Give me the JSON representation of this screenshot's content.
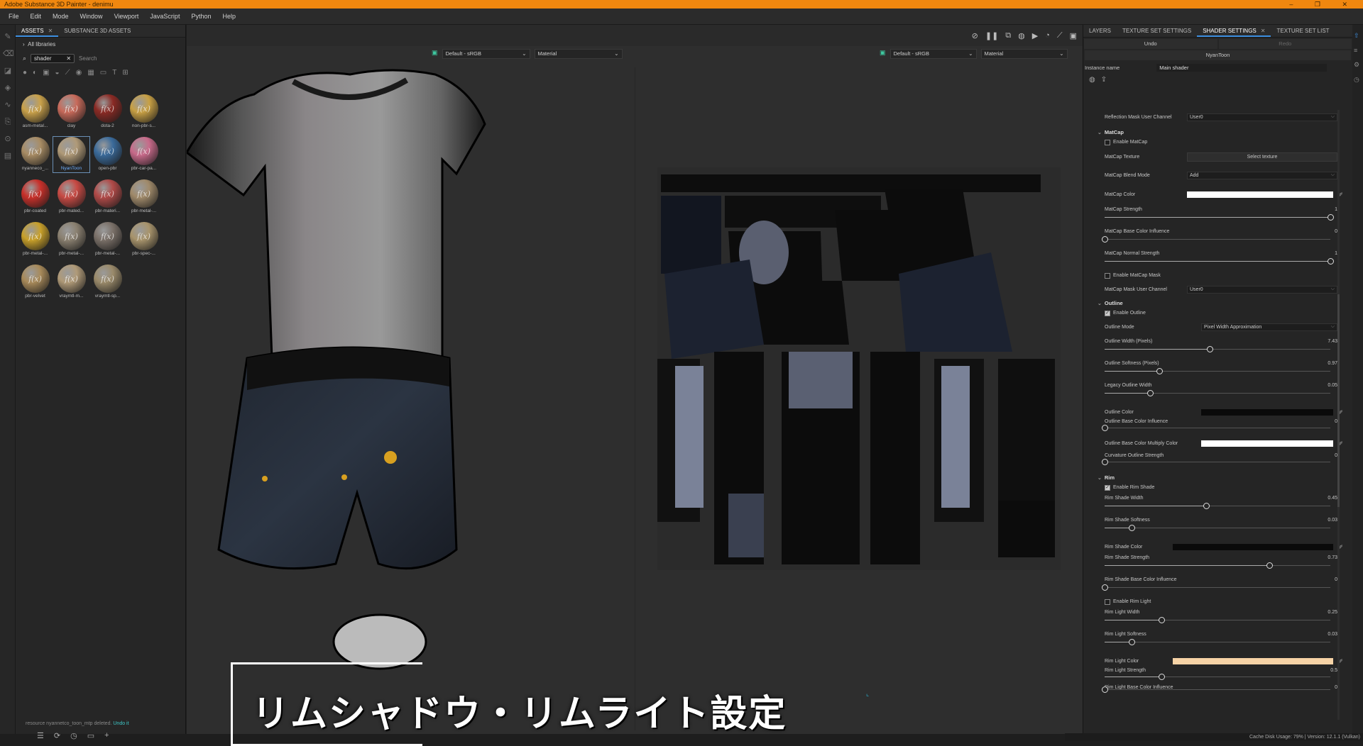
{
  "app": {
    "title": "Adobe Substance 3D Painter - denimu",
    "window_buttons": "– ❐ ✕"
  },
  "menu": [
    "File",
    "Edit",
    "Mode",
    "Window",
    "Viewport",
    "JavaScript",
    "Python",
    "Help"
  ],
  "assets_panel": {
    "tabs": [
      {
        "label": "ASSETS",
        "active": true
      },
      {
        "label": "SUBSTANCE 3D ASSETS",
        "active": false
      }
    ],
    "library": "All libraries",
    "search_chip": "shader",
    "search_placeholder": "Search",
    "items": [
      {
        "label": "asm-metal...",
        "color": "#c9a14a"
      },
      {
        "label": "clay",
        "color": "#c86a5a"
      },
      {
        "label": "dota-2",
        "color": "#8a2a24"
      },
      {
        "label": "non-pbr-s...",
        "color": "#c8a044"
      },
      {
        "label": "nyanneco_...",
        "color": "#a88c64"
      },
      {
        "label": "NyanToon",
        "color": "#b09a78",
        "selected": true
      },
      {
        "label": "open-pbr",
        "color": "#3a6a9a"
      },
      {
        "label": "pbr-car-pa...",
        "color": "#c86a8a"
      },
      {
        "label": "pbr-coated",
        "color": "#c8302a"
      },
      {
        "label": "pbr-mated...",
        "color": "#c84a44"
      },
      {
        "label": "pbr-materi...",
        "color": "#b04a48"
      },
      {
        "label": "pbr-metal-...",
        "color": "#a08a6a"
      },
      {
        "label": "pbr-metal-...",
        "color": "#c8a02a"
      },
      {
        "label": "pbr-metal-...",
        "color": "#8a8070"
      },
      {
        "label": "pbr-metal-...",
        "color": "#7a7068"
      },
      {
        "label": "pbr-spec-...",
        "color": "#a8946c"
      },
      {
        "label": "pbr-velvet",
        "color": "#a88a5a"
      },
      {
        "label": "vraymtl-m...",
        "color": "#b09a78"
      },
      {
        "label": "vraymtl-sp...",
        "color": "#9a8a6a"
      }
    ],
    "status_line": "resource nyannetco_toon_mtp deleted.",
    "status_ok": "Undo it"
  },
  "viewport": {
    "left_colorspace": "Default - sRGB",
    "left_channel": "Material",
    "right_colorspace": "Default - sRGB",
    "right_channel": "Material",
    "caption": "リムシャドウ・リムライト設定"
  },
  "right_panel": {
    "tabs": [
      {
        "label": "LAYERS",
        "active": false
      },
      {
        "label": "TEXTURE SET SETTINGS",
        "active": false
      },
      {
        "label": "SHADER SETTINGS",
        "active": true
      },
      {
        "label": "TEXTURE SET LIST",
        "active": false
      }
    ],
    "undo": "Undo",
    "redo": "Redo",
    "shader_name": "NyanToon",
    "instance_label": "Instance name",
    "instance_value": "Main shader",
    "reflection_mask_label": "Reflection Mask User Channel",
    "reflection_mask_value": "User0",
    "matcap": {
      "title": "MatCap",
      "enable": "Enable MatCap",
      "texture_label": "MatCap Texture",
      "texture_button": "Select texture",
      "blend_label": "MatCap Blend Mode",
      "blend_value": "Add",
      "color_label": "MatCap Color",
      "color": "#ffffff",
      "strength_label": "MatCap Strength",
      "strength": 1,
      "base_infl_label": "MatCap Base Color Influence",
      "base_infl": 0,
      "normal_label": "MatCap Normal Strength",
      "normal": 1,
      "enable_mask": "Enable MatCap Mask",
      "mask_channel_label": "MatCap Mask User Channel",
      "mask_channel_value": "User0"
    },
    "outline": {
      "title": "Outline",
      "enable": "Enable Outline",
      "mode_label": "Outline Mode",
      "mode_value": "Pixel Width Approximation",
      "width_label": "Outline Width (Pixels)",
      "width": 7.43,
      "softness_label": "Outline Softness (Pixels)",
      "softness": 0.97,
      "legacy_label": "Legacy Outline Width",
      "legacy": 0.05,
      "color_label": "Outline Color",
      "color": "#0a0a0a",
      "base_infl_label": "Outline Base Color Influence",
      "base_infl": 0,
      "multiply_label": "Outline Base Color Multiply Color",
      "multiply_color": "#ffffff",
      "curvature_label": "Curvature Outline Strength",
      "curvature": 0
    },
    "rim": {
      "title": "Rim",
      "enable_shade": "Enable Rim Shade",
      "shade_width_label": "Rim Shade Width",
      "shade_width": 0.45,
      "shade_softness_label": "Rim Shade Softness",
      "shade_softness": 0.03,
      "shade_color_label": "Rim Shade Color",
      "shade_color": "#0a0a0a",
      "shade_strength_label": "Rim Shade Strength",
      "shade_strength": 0.73,
      "shade_base_label": "Rim Shade Base Color Influence",
      "shade_base": 0,
      "enable_light": "Enable Rim Light",
      "light_width_label": "Rim Light Width",
      "light_width": 0.25,
      "light_softness_label": "Rim Light Softness",
      "light_softness": 0.03,
      "light_color_label": "Rim Light Color",
      "light_color": "#f6d3a6",
      "light_strength_label": "Rim Light Strength",
      "light_strength": 0.5,
      "light_base_label": "Rim Light Base Color Influence",
      "light_base": 0
    }
  },
  "statusbar": "Cache Disk Usage:   79% | Version: 12.1.1 (Vulkan)"
}
